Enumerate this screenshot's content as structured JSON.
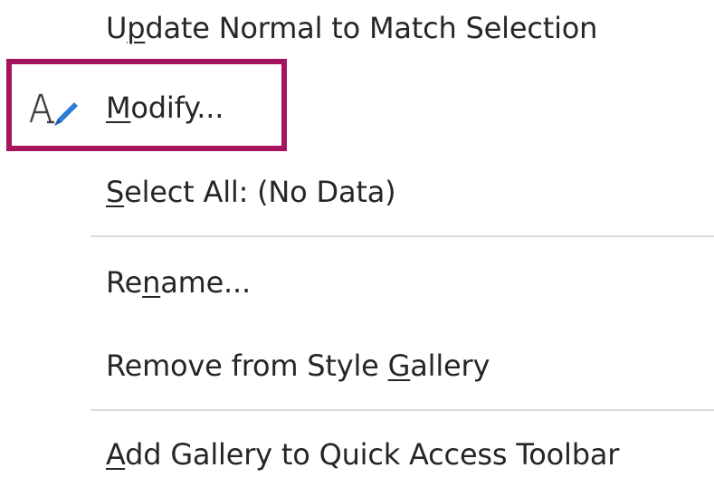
{
  "context_menu": {
    "items": [
      {
        "id": "update",
        "label_before": "U",
        "mnemonic": "p",
        "label_after": "date Normal to Match Selection"
      },
      {
        "id": "modify",
        "label_before": "",
        "mnemonic": "M",
        "label_after": "odify...",
        "icon": "style-modify-icon"
      },
      {
        "id": "select_all",
        "label_before": "",
        "mnemonic": "S",
        "label_after": "elect All: (No Data)"
      },
      {
        "id": "rename",
        "label_before": "Re",
        "mnemonic": "n",
        "label_after": "ame..."
      },
      {
        "id": "remove",
        "label_before": "Remove from Style ",
        "mnemonic": "G",
        "label_after": "allery"
      },
      {
        "id": "add_gallery",
        "label_before": "",
        "mnemonic": "A",
        "label_after": "dd Gallery to Quick Access Toolbar"
      }
    ],
    "highlight_color": "#a5155f",
    "icon_pencil_color": "#2b7cd3"
  }
}
